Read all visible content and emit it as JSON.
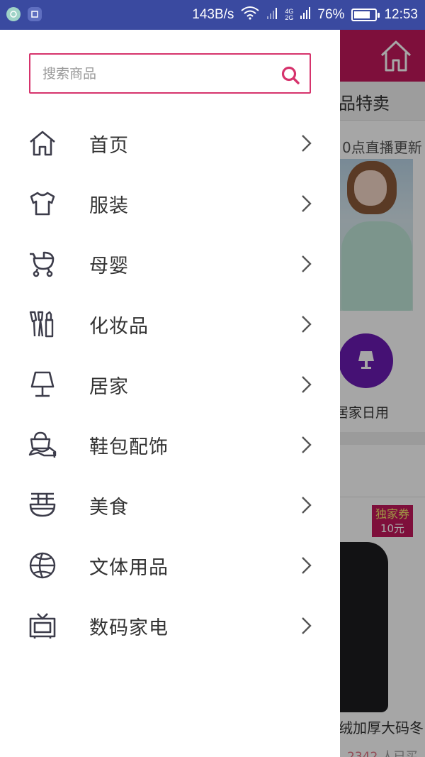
{
  "status_bar": {
    "net_speed": "143B/s",
    "net_type_top": "4G",
    "net_type_bottom": "2G",
    "battery_text": "76%",
    "battery_level": 0.76,
    "time": "12:53"
  },
  "background_app": {
    "tab_text": "品特卖",
    "live_text": "0点直播更新",
    "category_label": "居家日用",
    "coupon_title": "独家券",
    "coupon_value": "10元",
    "product_title": "绒加厚大码冬",
    "sold_count": "2342",
    "sold_suffix": " 人已买",
    "colors": {
      "header": "#c2185b",
      "category_circle": "#6a1bb3"
    }
  },
  "drawer": {
    "search": {
      "placeholder": "搜索商品",
      "value": ""
    },
    "menu": [
      {
        "icon": "home-icon",
        "label": "首页"
      },
      {
        "icon": "tshirt-icon",
        "label": "服装"
      },
      {
        "icon": "stroller-icon",
        "label": "母婴"
      },
      {
        "icon": "cosmetics-icon",
        "label": "化妆品"
      },
      {
        "icon": "lamp-icon",
        "label": "居家"
      },
      {
        "icon": "shoe-bag-icon",
        "label": "鞋包配饰"
      },
      {
        "icon": "food-bowl-icon",
        "label": "美食"
      },
      {
        "icon": "basketball-icon",
        "label": "文体用品"
      },
      {
        "icon": "tv-icon",
        "label": "数码家电"
      }
    ],
    "colors": {
      "accent": "#d6336c",
      "icon_stroke": "#3c3c4a"
    }
  }
}
